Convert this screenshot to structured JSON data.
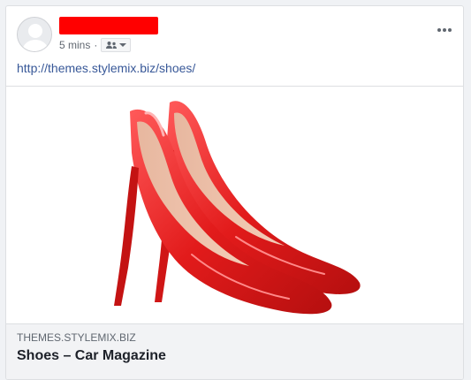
{
  "post": {
    "time": "5 mins",
    "dot": "·",
    "url": "http://themes.stylemix.biz/shoes/"
  },
  "link_preview": {
    "domain": "THEMES.STYLEMIX.BIZ",
    "title": "Shoes – Car Magazine"
  },
  "icons": {
    "avatar": "avatar-placeholder",
    "audience": "friends-icon",
    "dropdown": "chevron-down-icon",
    "more": "more-options-icon"
  },
  "colors": {
    "shoe_red": "#e21b1b",
    "link_blue": "#385898",
    "redaction": "#ff0000"
  }
}
